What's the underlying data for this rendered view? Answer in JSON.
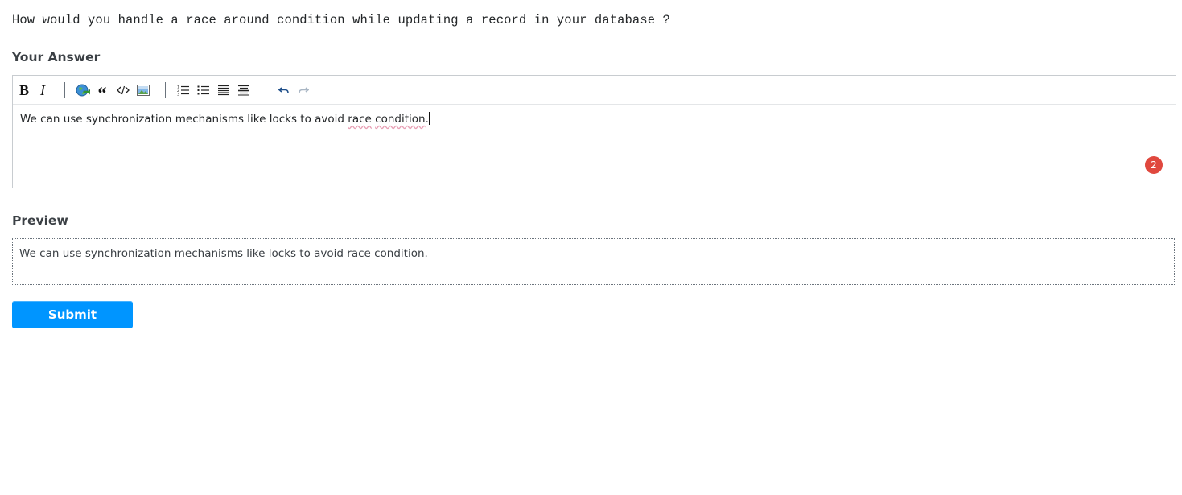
{
  "question": {
    "text": "How would you handle a race around condition while updating a record in your database ?"
  },
  "answer_section": {
    "label": "Your Answer",
    "toolbar": {
      "bold_label": "B",
      "italic_label": "I",
      "quote_label": "“",
      "icons": [
        "bold-icon",
        "italic-icon",
        "link-icon",
        "blockquote-icon",
        "code-icon",
        "image-icon",
        "numbered-list-icon",
        "bulleted-list-icon",
        "heading-icon",
        "horizontal-rule-icon",
        "undo-icon",
        "redo-icon"
      ]
    },
    "editor": {
      "text_before": "We can use synchronization mechanisms like locks to avoid ",
      "misspelled_1": "race",
      "between": " ",
      "misspelled_2": "condition",
      "text_after": ".",
      "badge_count": "2"
    }
  },
  "preview_section": {
    "label": "Preview",
    "text": "We can use synchronization mechanisms like locks to avoid race condition."
  },
  "submit": {
    "label": "Submit"
  },
  "colors": {
    "accent": "#0095ff",
    "badge": "#e0483e",
    "spellcheck": "#e8a0b5"
  }
}
